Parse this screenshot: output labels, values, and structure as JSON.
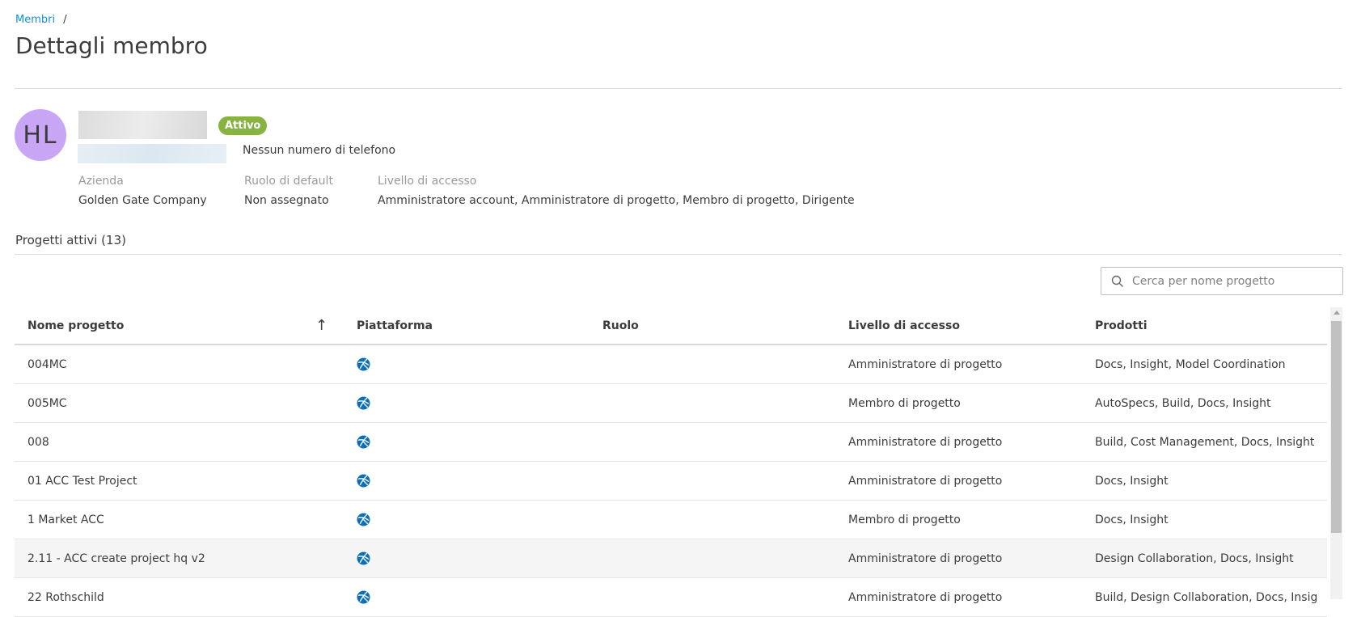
{
  "breadcrumb": {
    "parent": "Membri",
    "separator": "/"
  },
  "page_title": "Dettagli membro",
  "member": {
    "initials": "HL",
    "status": "Attivo",
    "phone": "Nessun numero di telefono",
    "fields": [
      {
        "label": "Azienda",
        "value": "Golden Gate Company"
      },
      {
        "label": "Ruolo di default",
        "value": "Non assegnato"
      },
      {
        "label": "Livello di accesso",
        "value": "Amministratore account, Amministratore di progetto, Membro di progetto, Dirigente"
      }
    ]
  },
  "projects_section": {
    "title": "Progetti attivi (13)"
  },
  "search": {
    "placeholder": "Cerca per nome progetto"
  },
  "table": {
    "columns": [
      "Nome progetto",
      "Piattaforma",
      "Ruolo",
      "Livello di accesso",
      "Prodotti"
    ],
    "sort_icon": "arrow-up-icon",
    "rows": [
      {
        "name": "004MC",
        "role": "",
        "access": "Amministratore di progetto",
        "products": "Docs, Insight, Model Coordination"
      },
      {
        "name": "005MC",
        "role": "",
        "access": "Membro di progetto",
        "products": "AutoSpecs, Build, Docs, Insight"
      },
      {
        "name": "008",
        "role": "",
        "access": "Amministratore di progetto",
        "products": "Build, Cost Management, Docs, Insight"
      },
      {
        "name": "01 ACC Test Project",
        "role": "",
        "access": "Amministratore di progetto",
        "products": "Docs, Insight"
      },
      {
        "name": "1 Market ACC",
        "role": "",
        "access": "Membro di progetto",
        "products": "Docs, Insight"
      },
      {
        "name": "2.11 - ACC create project hq v2",
        "role": "",
        "access": "Amministratore di progetto",
        "products": "Design Collaboration, Docs, Insight"
      },
      {
        "name": "22 Rothschild",
        "role": "",
        "access": "Amministratore di progetto",
        "products": "Build, Design Collaboration, Docs, Insig"
      }
    ]
  },
  "colors": {
    "accent": "#0696d7",
    "status_active": "#87b340",
    "avatar": "#c8a6f5",
    "platform_icon": "#0b6fb5"
  }
}
